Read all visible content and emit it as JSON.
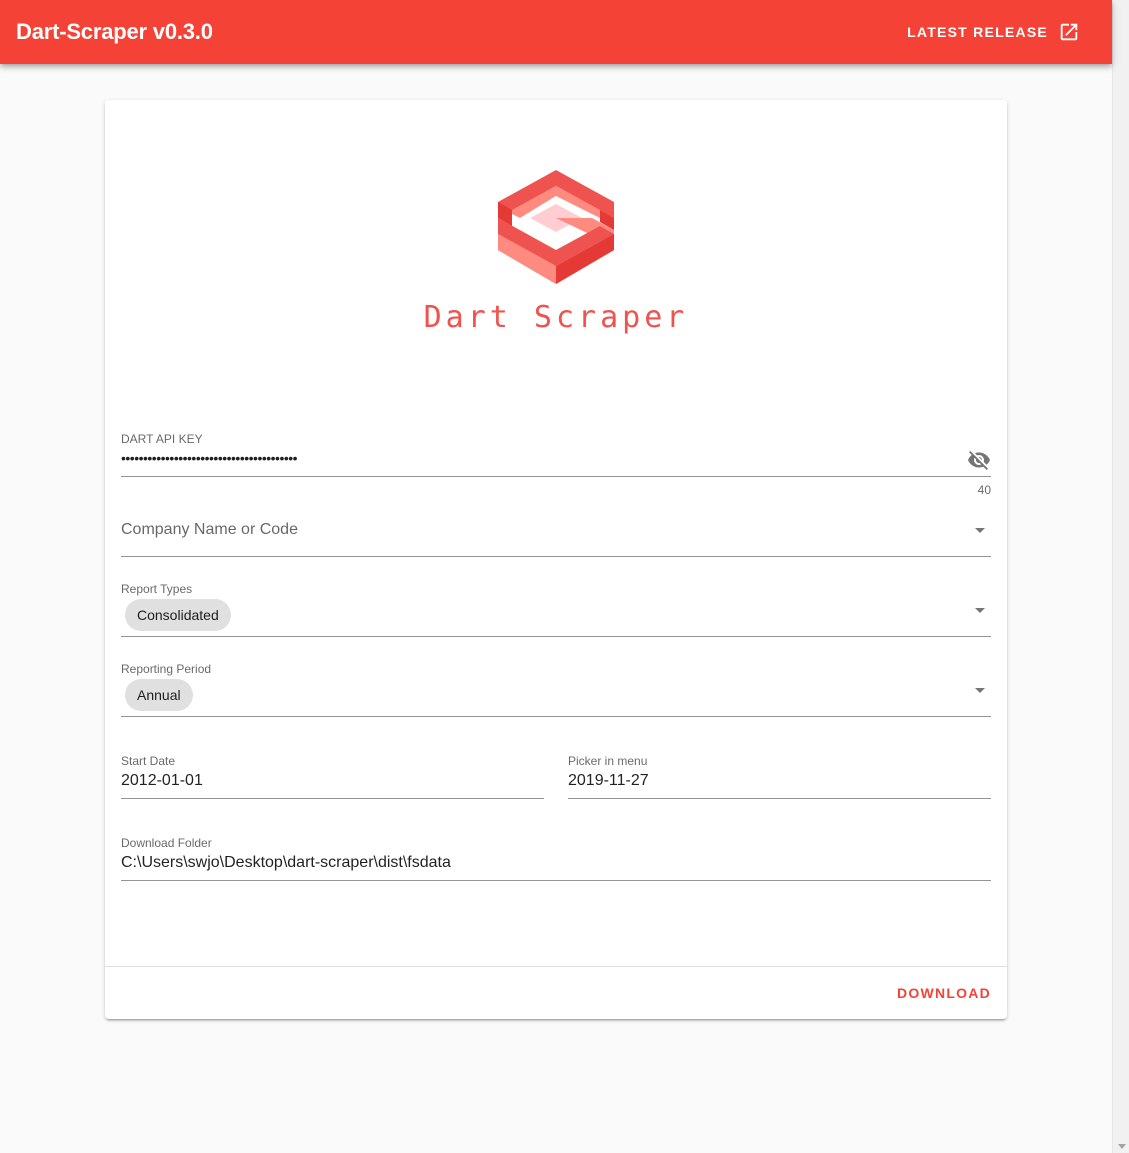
{
  "app_bar": {
    "title": "Dart-Scraper v0.3.0",
    "release_label": "LATEST RELEASE",
    "color": "#f44336"
  },
  "logo": {
    "text": "Dart Scraper",
    "color": "#ef5350"
  },
  "form": {
    "api_key": {
      "label": "DART API KEY",
      "value": "••••••••••••••••••••••••••••••••••••••••",
      "counter": "40"
    },
    "company": {
      "placeholder": "Company Name or Code"
    },
    "report_types": {
      "label": "Report Types",
      "selected": "Consolidated"
    },
    "reporting_period": {
      "label": "Reporting Period",
      "selected": "Annual"
    },
    "start_date": {
      "label": "Start Date",
      "value": "2012-01-01"
    },
    "end_date": {
      "label": "Picker in menu",
      "value": "2019-11-27"
    },
    "download_folder": {
      "label": "Download Folder",
      "value": "C:\\Users\\swjo\\Desktop\\dart-scraper\\dist\\fsdata"
    }
  },
  "actions": {
    "download_label": "DOWNLOAD"
  }
}
